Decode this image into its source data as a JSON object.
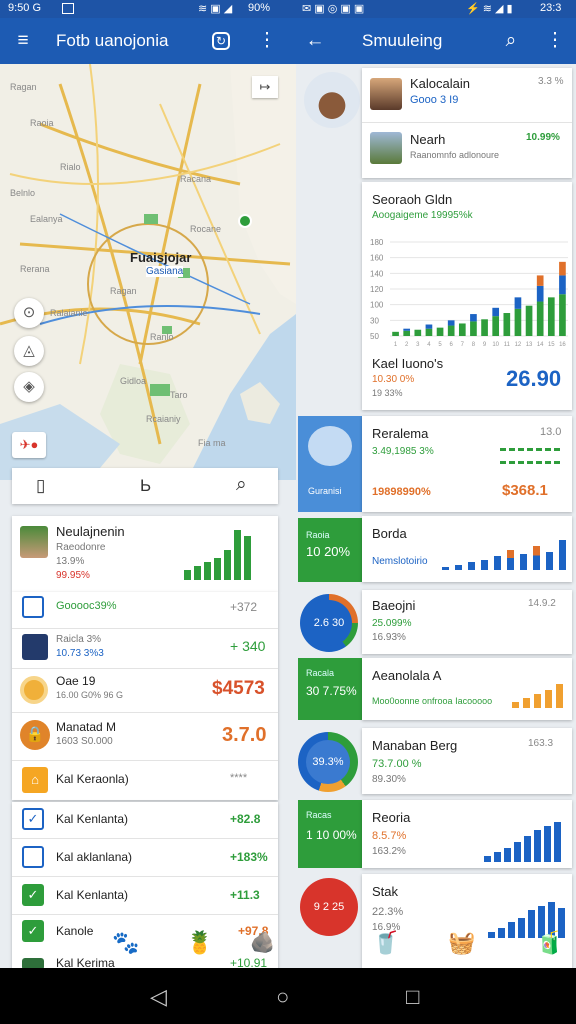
{
  "status": {
    "left_time": "9:50 G",
    "left_battery": "90%",
    "right_time": "23:3"
  },
  "left_bar": {
    "title": "Fotb uanojonia"
  },
  "right_bar": {
    "title": "Smuuleing"
  },
  "map": {
    "center_label": "Fuaisjojar",
    "center_sub": "Gasiana",
    "city_labels": [
      "Ragan",
      "Raoia",
      "Rialo",
      "Belnlo",
      "Ealanya",
      "Racana",
      "Rocane",
      "Rerana",
      "Ragan",
      "Ralaianie",
      "Ranlo",
      "Gidloa",
      "Taro",
      "Rcaianiy",
      "Fia ma"
    ],
    "tabs": [
      "▯",
      "Ь",
      "⌕"
    ]
  },
  "left_list": {
    "featured": {
      "title": "Neulajnenin",
      "sub1": "Raeodonre",
      "sub2": "13.9%",
      "change": "99.95%"
    },
    "rows": [
      {
        "name": "Gooooc39%",
        "value": "+372"
      },
      {
        "name": "Raicla 3%",
        "sub": "10.73 3%3",
        "value": "+ 340"
      },
      {
        "name": "Oae 19",
        "sub": "16.00 G0% 96 G",
        "value": "$4573"
      },
      {
        "name": "Manatad M",
        "sub": "1603 S0.000",
        "value": "3.7.0"
      },
      {
        "name": "Kal Keraonla)",
        "value": "****"
      },
      {
        "name": "Kal Kenlanta)",
        "value": "+82.8"
      },
      {
        "name": "Kal aklanlana)",
        "value": "+183%"
      },
      {
        "name": "Kal Kenlanta)",
        "value": "+11.3"
      },
      {
        "name": "Kanole",
        "value": "+97.8"
      },
      {
        "name": "Kal Kerima",
        "value": "+10.91"
      }
    ]
  },
  "right_list": {
    "top": [
      {
        "name": "Kalocalain",
        "sub": "Gooo 3 I9",
        "value": "3.3 %"
      },
      {
        "name": "Nearh",
        "sub": "Raanomnfo adlonoure",
        "value": "10.99%"
      }
    ],
    "chart_card": {
      "title": "Seoraoh Gldn",
      "sub": "Aoogaigeme 19995%k",
      "chart_name": "Kael Iuono's",
      "chart_sub1": "10.30 0%",
      "chart_sub2": "19 33%",
      "big_value": "26.90",
      "ticks": [
        "180",
        "160",
        "140",
        "120",
        "100",
        "30",
        "50"
      ]
    },
    "cards": [
      {
        "title": "Reralema",
        "sub": "3.49,1985 3%",
        "val_top": "13.0",
        "big": "19898990%",
        "value": "$368.1",
        "thumb_sub": "Guranisi"
      },
      {
        "title": "Borda",
        "sub": "Nemslotoirio",
        "thumb_top": "Raoia",
        "thumb_val": "10 20%"
      },
      {
        "title": "Baeojni",
        "sub1": "25.099%",
        "sub2": "16.93%",
        "val_top": "14.9.2",
        "pie_label": "2.6 30"
      },
      {
        "title": "Aeanolala A",
        "sub": "Moo0oonne onfrooa Iacooooo",
        "thumb_top": "Racala",
        "thumb_val": "30 7.75%"
      },
      {
        "title": "Manaban Berg",
        "sub1": "73.7.00 %",
        "sub2": "89.30%",
        "val_top": "163.3",
        "pie_label": "39.3%"
      },
      {
        "title": "Reoria",
        "sub1": "8.5.7%",
        "sub2": "163.2%",
        "thumb_top": "Racas",
        "thumb_val": "1 10 00%"
      },
      {
        "title": "Stak",
        "sub1": "22.3%",
        "sub2": "16.9%",
        "pie_label": "9 2 25"
      }
    ]
  },
  "chart_data": {
    "type": "bar",
    "categories": [
      "1",
      "2",
      "3",
      "4",
      "5",
      "6",
      "7",
      "8",
      "9",
      "10",
      "11",
      "12",
      "13",
      "14",
      "15",
      "16"
    ],
    "series": [
      {
        "name": "green",
        "values": [
          8,
          10,
          12,
          14,
          16,
          20,
          24,
          28,
          32,
          38,
          44,
          52,
          58,
          66,
          74,
          80
        ]
      },
      {
        "name": "blue",
        "values": [
          0,
          4,
          0,
          8,
          0,
          10,
          0,
          14,
          0,
          16,
          0,
          22,
          0,
          30,
          0,
          36
        ]
      },
      {
        "name": "orange",
        "values": [
          0,
          0,
          0,
          0,
          0,
          0,
          0,
          0,
          0,
          0,
          0,
          0,
          0,
          20,
          0,
          26
        ]
      }
    ],
    "ylim": [
      0,
      180
    ]
  },
  "colors": {
    "primary": "#1d5bb3",
    "green": "#2e9d3b",
    "orange": "#e0702a",
    "red": "#d8342b",
    "blue": "#1c63c4"
  },
  "bottom_icons": [
    "🐾",
    "🍍",
    "🪨",
    "🥤",
    "🧺",
    "🧃"
  ]
}
